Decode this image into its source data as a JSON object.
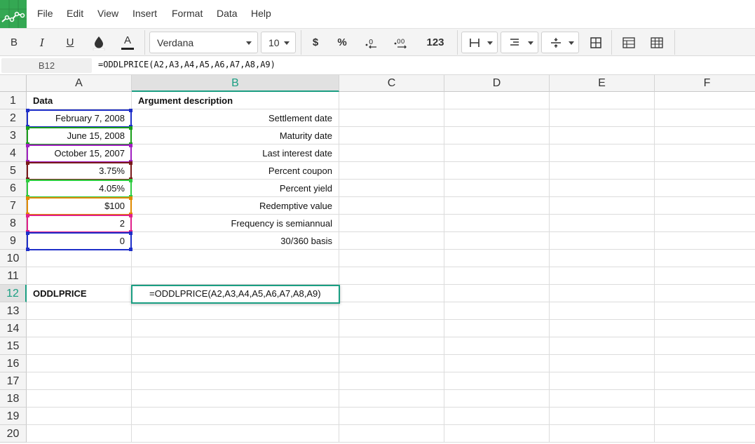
{
  "app": {
    "menu": [
      "File",
      "Edit",
      "View",
      "Insert",
      "Format",
      "Data",
      "Help"
    ]
  },
  "toolbar": {
    "bold": "B",
    "italic": "I",
    "underline": "U",
    "text_color": "A",
    "font_family": "Verdana",
    "font_size": "10",
    "currency": "$",
    "percent": "%",
    "number_format": "123",
    "icons": [
      "fill-color-icon",
      "decrease-decimals-icon",
      "increase-decimals-icon",
      "borders-icon",
      "align-icon",
      "valign-icon",
      "merge-icon",
      "freeze-icon",
      "grid-icon"
    ]
  },
  "formula_bar": {
    "cell_ref": "B12",
    "formula": "=ODDLPRICE(A2,A3,A4,A5,A6,A7,A8,A9)"
  },
  "columns": [
    "A",
    "B",
    "C",
    "D",
    "E",
    "F"
  ],
  "selected_column": "B",
  "rows": [
    "1",
    "2",
    "3",
    "4",
    "5",
    "6",
    "7",
    "8",
    "9",
    "10",
    "11",
    "12",
    "13",
    "14",
    "15",
    "16",
    "17",
    "18",
    "19",
    "20"
  ],
  "selected_row": "12",
  "cells": {
    "A1": "Data",
    "B1": "Argument description",
    "A2": "February 7, 2008",
    "B2": "Settlement date",
    "A3": "June 15, 2008",
    "B3": "Maturity date",
    "A4": "October 15, 2007",
    "B4": "Last interest date",
    "A5": "3.75%",
    "B5": "Percent coupon",
    "A6": "4.05%",
    "B6": "Percent yield",
    "A7": "$100",
    "B7": "Redemptive value",
    "A8": "2",
    "B8": "Frequency is semiannual",
    "A9": "0",
    "B9": "30/360 basis",
    "A12": "ODDLPRICE",
    "B12": "=ODDLPRICE(A2,A3,A4,A5,A6,A7,A8,A9)"
  },
  "reference_colors": {
    "A2": "#1f2fc9",
    "A3": "#1a9e1a",
    "A4": "#a020c0",
    "A5": "#7a1a1a",
    "A6": "#2ecc40",
    "A7": "#e08a00",
    "A8": "#e0208a",
    "A9": "#1f2fc9"
  },
  "colors": {
    "accent": "#1a9e82",
    "logo": "#34a853"
  }
}
